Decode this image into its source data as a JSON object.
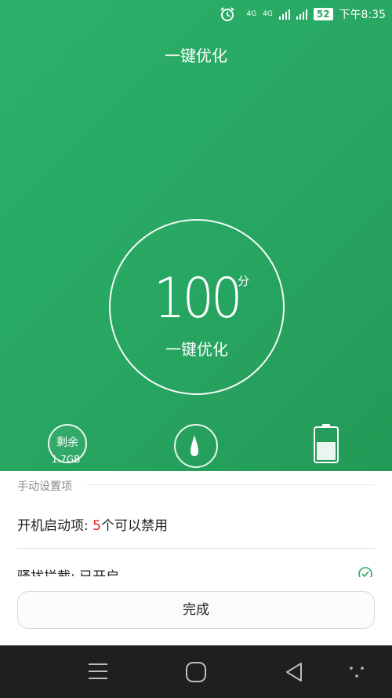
{
  "status_bar": {
    "network_label_1": "4G",
    "network_label_2": "4G",
    "battery_level": "52",
    "time": "下午8:35"
  },
  "header": {
    "title": "一键优化"
  },
  "score_circle": {
    "score": "100",
    "unit": "分",
    "label": "一键优化"
  },
  "stats": {
    "remaining_label": "剩余",
    "remaining_value": "1.7GB"
  },
  "manual_section": {
    "title": "手动设置项",
    "startup_label": "开机启动项: ",
    "startup_count": "5",
    "startup_suffix": "个可以禁用",
    "harass_label": "骚扰拦截: 已开启"
  },
  "done_button": {
    "label": "完成"
  },
  "nav_bar": {
    "menu": "menu-icon",
    "home": "home-icon",
    "back": "back-icon",
    "extra": "dots-icon"
  }
}
